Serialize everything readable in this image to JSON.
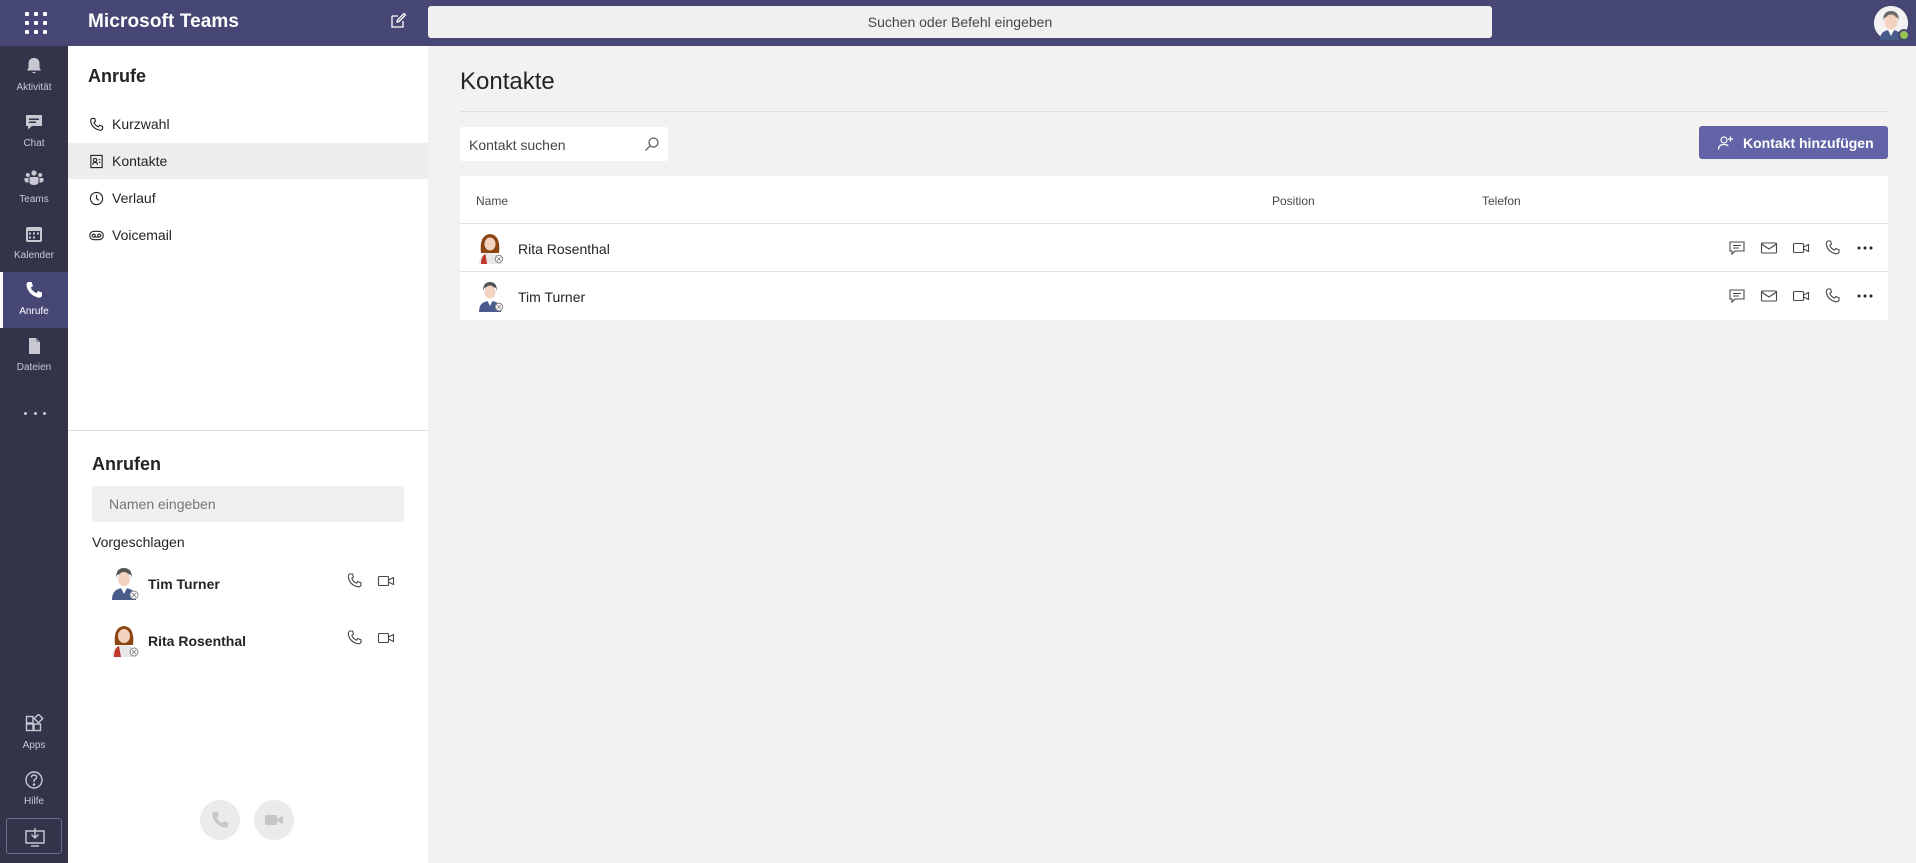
{
  "topbar": {
    "app_title": "Microsoft Teams",
    "search_placeholder": "Suchen oder Befehl eingeben",
    "icons": [
      "app-launcher-icon",
      "compose-icon",
      "profile-avatar"
    ]
  },
  "rail": {
    "items": [
      {
        "label": "Aktivität",
        "icon": "bell-icon"
      },
      {
        "label": "Chat",
        "icon": "chat-icon"
      },
      {
        "label": "Teams",
        "icon": "teams-icon"
      },
      {
        "label": "Kalender",
        "icon": "calendar-icon"
      },
      {
        "label": "Anrufe",
        "icon": "phone-icon",
        "active": true
      },
      {
        "label": "Dateien",
        "icon": "file-icon"
      }
    ],
    "bottom_items": [
      {
        "label": "Apps",
        "icon": "apps-icon"
      },
      {
        "label": "Hilfe",
        "icon": "help-icon"
      }
    ]
  },
  "pane": {
    "title": "Anrufe",
    "nav": [
      {
        "label": "Kurzwahl",
        "icon": "phone-icon"
      },
      {
        "label": "Kontakte",
        "icon": "contact-card-icon",
        "selected": true
      },
      {
        "label": "Verlauf",
        "icon": "clock-icon"
      },
      {
        "label": "Voicemail",
        "icon": "voicemail-icon"
      }
    ],
    "call_section": {
      "title": "Anrufen",
      "name_placeholder": "Namen eingeben",
      "suggested_label": "Vorgeschlagen",
      "suggested": [
        {
          "name": "Tim Turner"
        },
        {
          "name": "Rita Rosenthal"
        }
      ]
    }
  },
  "main": {
    "title": "Kontakte",
    "search_placeholder": "Kontakt suchen",
    "add_button_label": "Kontakt hinzufügen",
    "columns": {
      "name": "Name",
      "position": "Position",
      "phone": "Telefon"
    },
    "rows": [
      {
        "name": "Rita Rosenthal",
        "position": "",
        "phone": ""
      },
      {
        "name": "Tim Turner",
        "position": "",
        "phone": ""
      }
    ]
  },
  "colors": {
    "topbar": "#464775",
    "rail": "#33344a",
    "accent": "#6264a7",
    "available": "#92c353"
  }
}
